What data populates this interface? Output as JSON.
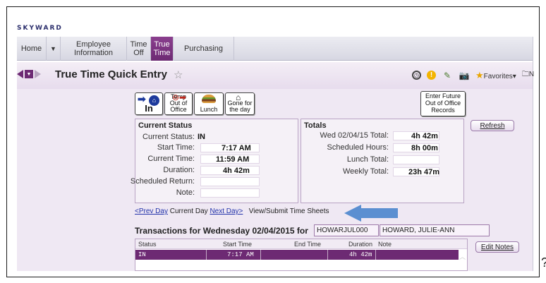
{
  "logo": "SKYWARD",
  "nav": {
    "home": "Home",
    "dropdown": "▼",
    "employee_information": "Employee Information",
    "time_off": "Time Off",
    "true_time": "True Time",
    "purchasing": "Purchasing"
  },
  "page": {
    "title": "True Time Quick Entry",
    "favorites": "Favorites▾",
    "extra": "N"
  },
  "punch_buttons": {
    "in": "In",
    "temp_out": "Temp Out of Office",
    "lunch": "Lunch",
    "gone": "Gone for the day",
    "future": "Enter Future Out of Office Records"
  },
  "current_status": {
    "heading": "Current Status",
    "status_label": "Current Status:",
    "status_value": "IN",
    "start_label": "Start Time:",
    "start_value": "7:17 AM",
    "current_label": "Current Time:",
    "current_value": "11:59 AM",
    "duration_label": "Duration:",
    "duration_value": "4h 42m",
    "return_label": "Scheduled Return:",
    "note_label": "Note:"
  },
  "totals": {
    "heading": "Totals",
    "day_label": "Wed 02/04/15 Total:",
    "day_value": "4h 42m",
    "scheduled_label": "Scheduled Hours:",
    "scheduled_value": "8h 00m",
    "lunch_label": "Lunch Total:",
    "weekly_label": "Weekly Total:",
    "weekly_value": "23h 47m"
  },
  "refresh_button": "Refresh",
  "day_nav": {
    "prev": "<Prev Day",
    "current": "Current Day",
    "next": "Next Day>",
    "view_submit": "View/Submit Time Sheets"
  },
  "transactions": {
    "title": "Transactions for Wednesday 02/04/2015 for",
    "employee_id": "HOWARJUL000",
    "employee_name": "HOWARD, JULIE-ANN",
    "columns": [
      "Status",
      "Start Time",
      "End Time",
      "Duration",
      "Note"
    ],
    "rows": [
      {
        "status": "IN",
        "start": "7:17 AM",
        "end": "",
        "duration": "4h 42m",
        "note": ""
      }
    ]
  },
  "edit_notes_button": "Edit Notes",
  "question_mark": "?",
  "colors": {
    "brand_purple": "#6d2a73",
    "annotation_arrow": "#5b8fd1"
  }
}
